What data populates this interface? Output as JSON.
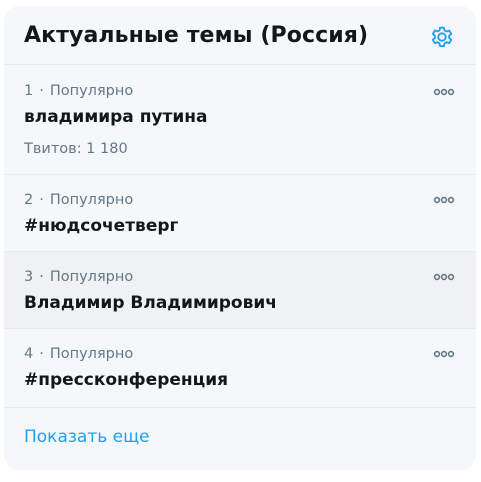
{
  "header": {
    "title": "Актуальные темы (Россия)",
    "settings_icon": "gear-icon",
    "accent_color": "#1da1f2"
  },
  "trends": [
    {
      "rank": "1",
      "context": "Популярно",
      "name": "владимира путина",
      "tweets": "Твитов: 1 180"
    },
    {
      "rank": "2",
      "context": "Популярно",
      "name": "#нюдсочетверг"
    },
    {
      "rank": "3",
      "context": "Популярно",
      "name": "Владимир Владимирович"
    },
    {
      "rank": "4",
      "context": "Популярно",
      "name": "#прессконференция"
    }
  ],
  "separator": "·",
  "more_icon": "more-horizontal-icon",
  "footer": {
    "show_more": "Показать еще"
  }
}
